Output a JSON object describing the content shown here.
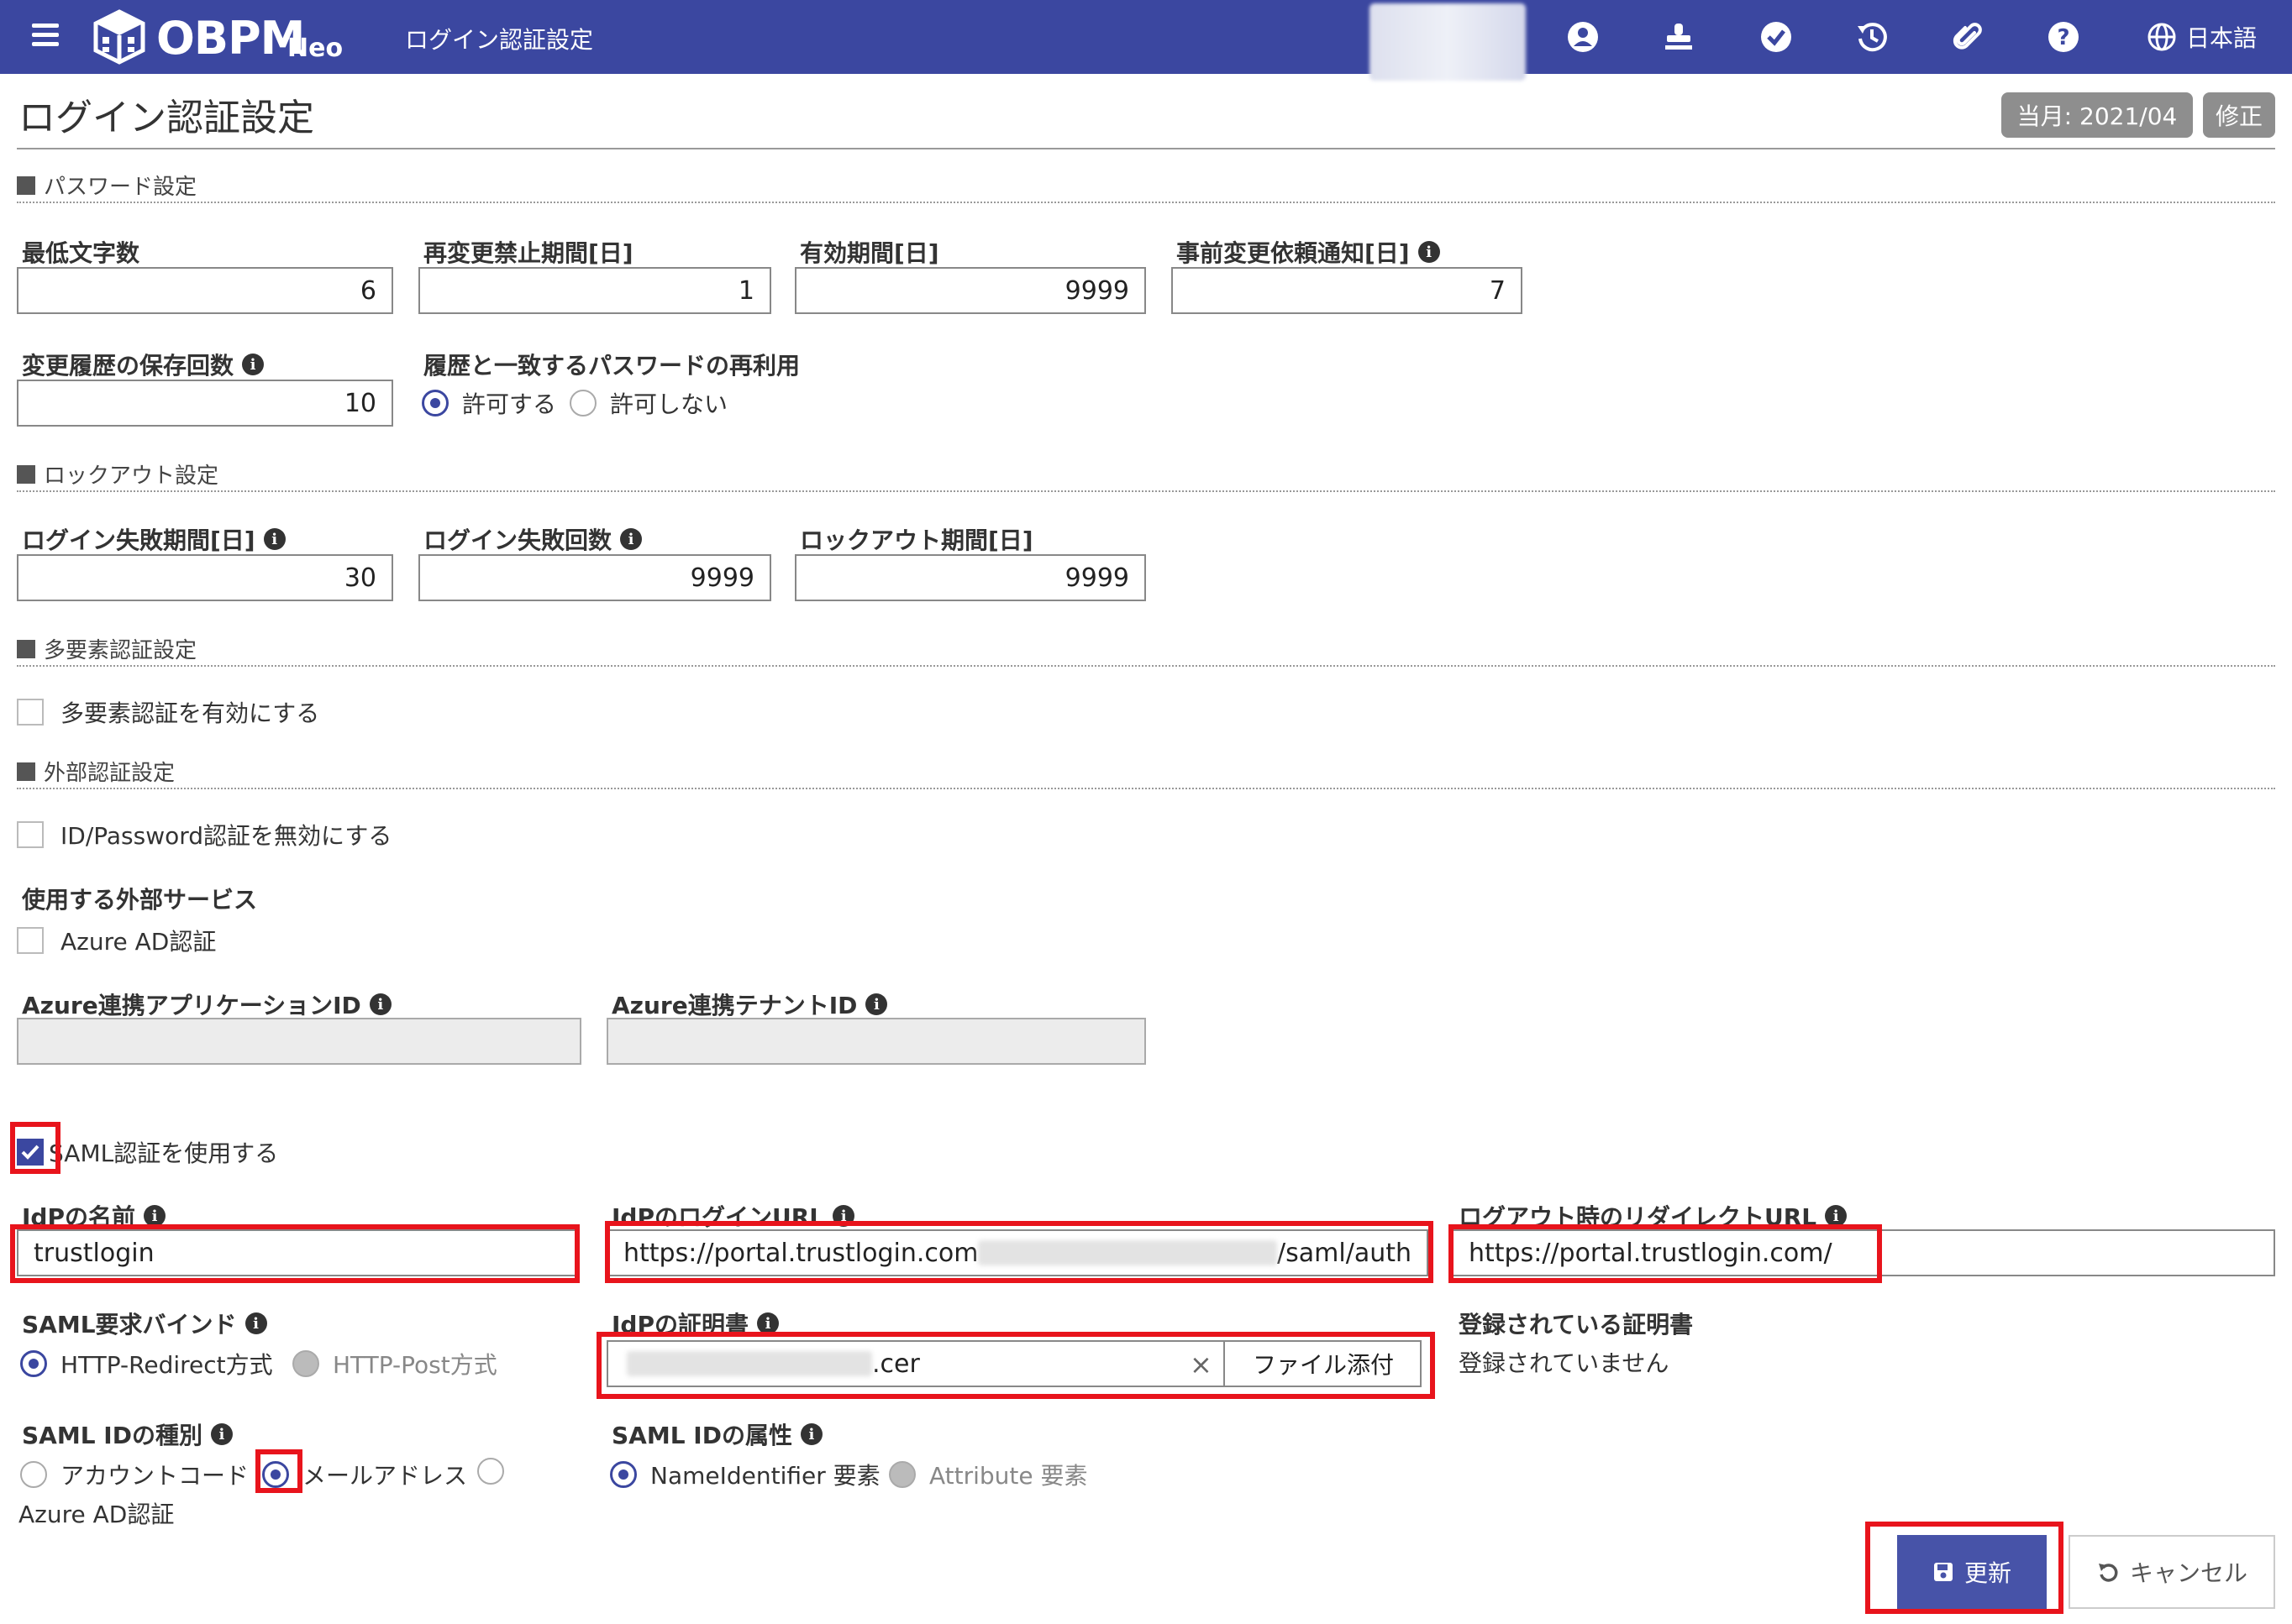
{
  "topbar": {
    "app_name": "OBPM",
    "app_suffix": "Neo",
    "screen_title": "ログイン認証設定",
    "language": "日本語",
    "colors": {
      "bar": "#3b47a0",
      "highlight": "#e8141c"
    }
  },
  "header": {
    "title": "ログイン認証設定",
    "period_badge": "当月: 2021/04",
    "edit_badge": "修正"
  },
  "password": {
    "section": "パスワード設定",
    "min_length_label": "最低文字数",
    "min_length": "6",
    "no_change_label": "再変更禁止期間[日]",
    "no_change": "1",
    "valid_label": "有効期間[日]",
    "valid": "9999",
    "notice_label": "事前変更依頼通知[日]",
    "notice": "7",
    "history_label": "変更履歴の保存回数",
    "history": "10",
    "reuse_label": "履歴と一致するパスワードの再利用",
    "reuse_allow": "許可する",
    "reuse_deny": "許可しない"
  },
  "lockout": {
    "section": "ロックアウト設定",
    "period_label": "ログイン失敗期間[日]",
    "period": "30",
    "count_label": "ログイン失敗回数",
    "count": "9999",
    "lock_label": "ロックアウト期間[日]",
    "lock": "9999"
  },
  "mfa": {
    "section": "多要素認証設定",
    "enable_label": "多要素認証を有効にする"
  },
  "external": {
    "section": "外部認証設定",
    "disable_idpw_label": "ID/Password認証を無効にする",
    "services_label": "使用する外部サービス",
    "azure_label": "Azure AD認証",
    "azure_app_label": "Azure連携アプリケーションID",
    "azure_tenant_label": "Azure連携テナントID",
    "saml_label": "SAML認証を使用する",
    "idp_name_label": "IdPの名前",
    "idp_name": "trustlogin",
    "idp_login_label": "IdPのログインURL",
    "idp_login_prefix": "https://portal.trustlogin.com",
    "idp_login_suffix": "/saml/auth",
    "logout_label": "ログアウト時のリダイレクトURL",
    "logout_url": "https://portal.trustlogin.com/",
    "bind_label": "SAML要求バインド",
    "bind_redirect": "HTTP-Redirect方式",
    "bind_post": "HTTP-Post方式",
    "cert_label": "IdPの証明書",
    "cert_file": ".cer",
    "cert_attach": "ファイル添付",
    "cert_clear": "×",
    "registered_label": "登録されている証明書",
    "registered_value": "登録されていません",
    "idtype_label": "SAML IDの種別",
    "idtype_account": "アカウントコード",
    "idtype_mail": "メールアドレス",
    "idtype_azure": "Azure AD認証",
    "attr_label": "SAML IDの属性",
    "attr_nameid": "NameIdentifier 要素",
    "attr_attribute": "Attribute 要素"
  },
  "actions": {
    "update": "更新",
    "cancel": "キャンセル"
  }
}
